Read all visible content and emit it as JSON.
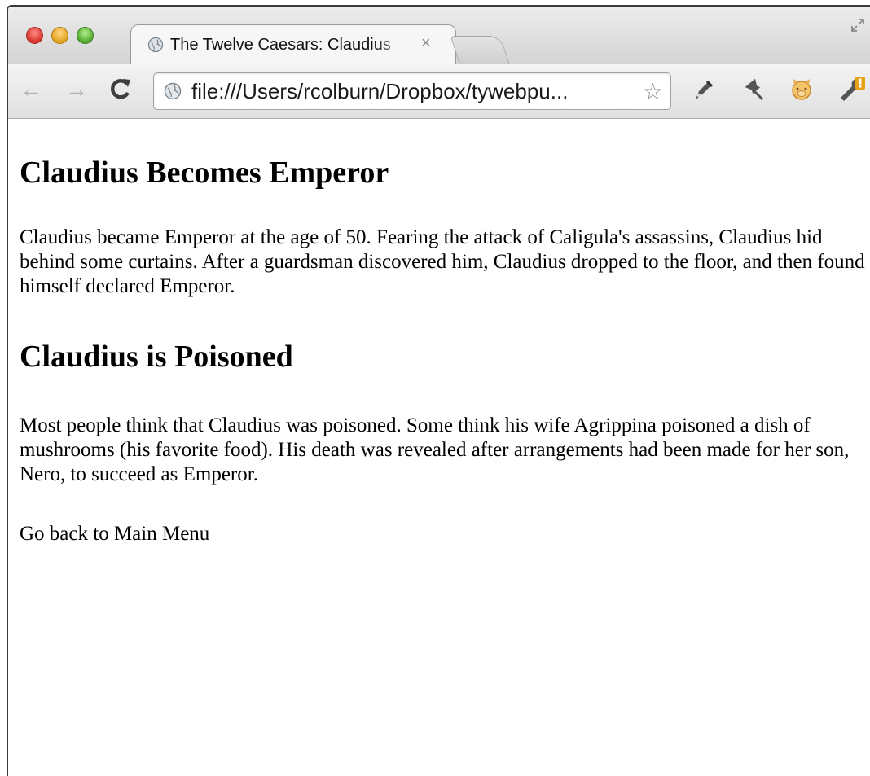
{
  "browser": {
    "tab_title": "The Twelve Caesars: Claudius",
    "tab_close_glyph": "×",
    "nav": {
      "back_glyph": "←",
      "forward_glyph": "→"
    },
    "address_url": "file:///Users/rcolburn/Dropbox/tywebpu...",
    "bookmark_glyph": "☆",
    "icons": [
      "globe-icon",
      "close-icon",
      "new-tab-icon",
      "back-arrow-icon",
      "forward-arrow-icon",
      "reload-icon",
      "star-icon",
      "pen-icon",
      "pin-icon",
      "pig-extension-icon",
      "wrench-icon",
      "fullscreen-icon"
    ],
    "colors": {
      "titlebar": "#d4d4d4",
      "toolbar": "#e0e0e0",
      "wrench_badge": "#e6a31a"
    }
  },
  "page": {
    "sections": [
      {
        "heading": "Claudius Becomes Emperor",
        "paragraph": "Claudius became Emperor at the age of 50. Fearing the attack of Caligula's assassins, Claudius hid behind some curtains. After a guardsman discovered him, Claudius dropped to the floor, and then found himself declared Emperor."
      },
      {
        "heading": "Claudius is Poisoned",
        "paragraph": "Most people think that Claudius was poisoned. Some think his wife Agrippina poisoned a dish of mushrooms (his favorite food). His death was revealed after arrangements had been made for her son, Nero, to succeed as Emperor."
      }
    ],
    "back_link": "Go back to Main Menu"
  }
}
